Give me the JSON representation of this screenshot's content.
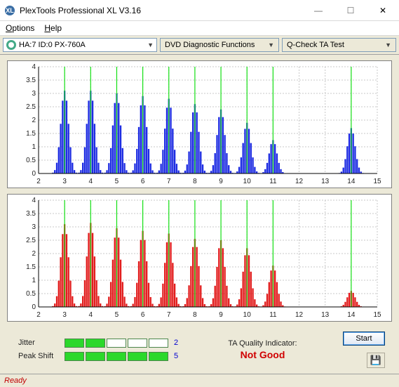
{
  "window": {
    "title": "PlexTools Professional XL V3.16",
    "min": "—",
    "max": "☐",
    "close": "✕"
  },
  "menu": {
    "options": "Options",
    "help": "Help"
  },
  "toolbar": {
    "drive": "HA:7 ID:0   PX-760A",
    "func": "DVD Diagnostic Functions",
    "test": "Q-Check TA Test"
  },
  "chart_data": [
    {
      "type": "bar",
      "color": "blue",
      "xlim": [
        2,
        15
      ],
      "ylim": [
        0,
        4
      ],
      "yticks": [
        0,
        0.5,
        1,
        1.5,
        2,
        2.5,
        3,
        3.5,
        4
      ],
      "xticks": [
        2,
        3,
        4,
        5,
        6,
        7,
        8,
        9,
        10,
        11,
        12,
        13,
        14,
        15
      ],
      "marks": [
        3,
        4,
        5,
        6,
        7,
        8,
        9,
        10,
        11,
        14
      ],
      "peaks": [
        {
          "x": 3,
          "y": 3.1
        },
        {
          "x": 4,
          "y": 3.1
        },
        {
          "x": 5,
          "y": 3.0
        },
        {
          "x": 6,
          "y": 2.9
        },
        {
          "x": 7,
          "y": 2.8
        },
        {
          "x": 8,
          "y": 2.6
        },
        {
          "x": 9,
          "y": 2.4
        },
        {
          "x": 10,
          "y": 1.9
        },
        {
          "x": 11,
          "y": 1.25
        },
        {
          "x": 14,
          "y": 1.7
        }
      ]
    },
    {
      "type": "bar",
      "color": "red",
      "xlim": [
        2,
        15
      ],
      "ylim": [
        0,
        4
      ],
      "yticks": [
        0,
        0.5,
        1,
        1.5,
        2,
        2.5,
        3,
        3.5,
        4
      ],
      "xticks": [
        2,
        3,
        4,
        5,
        6,
        7,
        8,
        9,
        10,
        11,
        12,
        13,
        14,
        15
      ],
      "marks": [
        3,
        4,
        5,
        6,
        7,
        8,
        9,
        10,
        11,
        14
      ],
      "peaks": [
        {
          "x": 3,
          "y": 3.1
        },
        {
          "x": 4,
          "y": 3.15
        },
        {
          "x": 5,
          "y": 2.95
        },
        {
          "x": 6,
          "y": 2.85
        },
        {
          "x": 7,
          "y": 2.75
        },
        {
          "x": 8,
          "y": 2.55
        },
        {
          "x": 9,
          "y": 2.5
        },
        {
          "x": 10,
          "y": 2.2
        },
        {
          "x": 11,
          "y": 1.55
        },
        {
          "x": 14,
          "y": 0.6
        }
      ]
    }
  ],
  "meters": {
    "jitter_label": "Jitter",
    "jitter_value": "2",
    "jitter_fill": 2,
    "peak_label": "Peak Shift",
    "peak_value": "5",
    "peak_fill": 5
  },
  "ta": {
    "label": "TA Quality Indicator:",
    "value": "Not Good"
  },
  "buttons": {
    "start": "Start",
    "save": "💾"
  },
  "status": "Ready"
}
